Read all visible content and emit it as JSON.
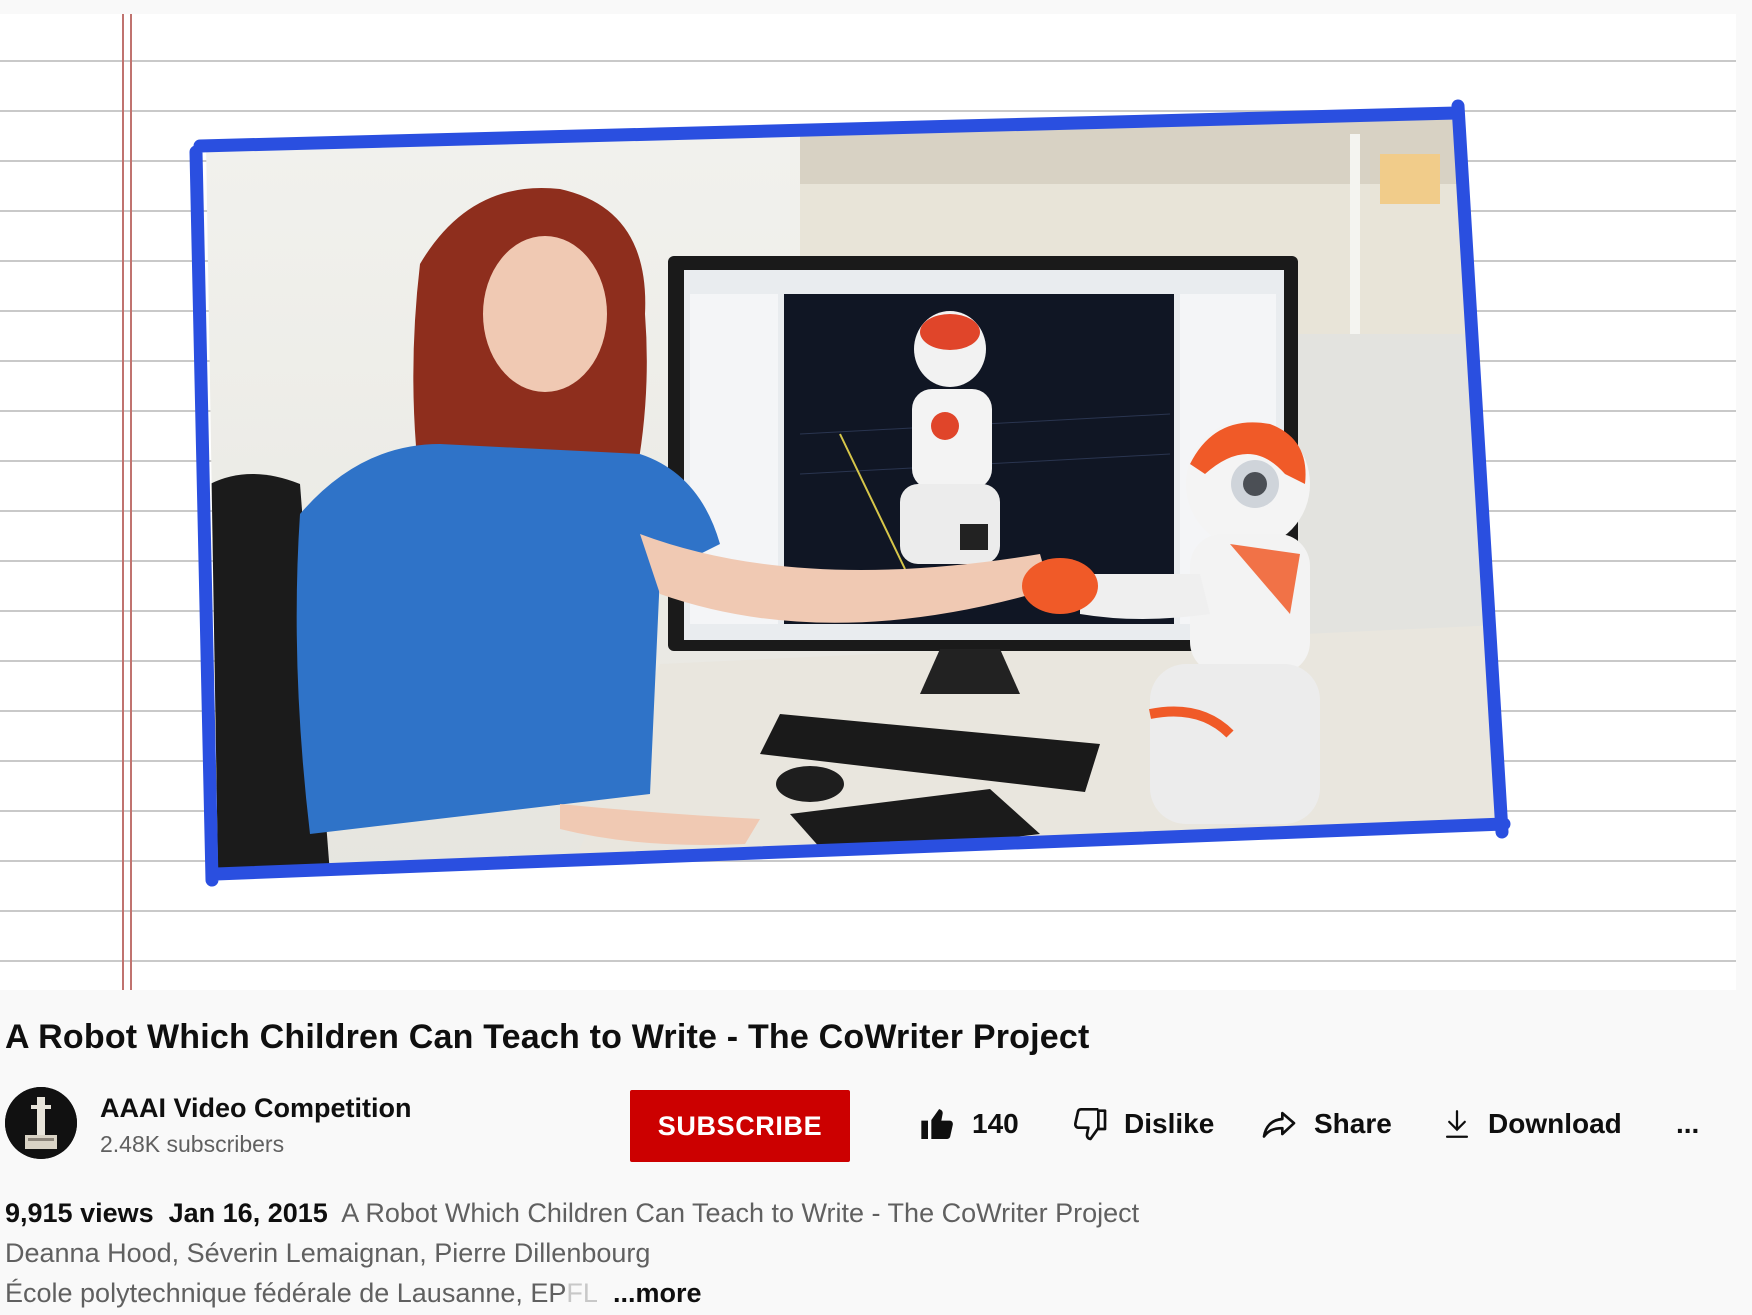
{
  "video": {
    "title": "A Robot Which Children Can Teach to Write - The CoWriter Project"
  },
  "channel": {
    "name": "AAAI Video Competition",
    "subscribers": "2.48K subscribers"
  },
  "actions": {
    "subscribe_label": "SUBSCRIBE",
    "like_count": "140",
    "dislike_label": "Dislike",
    "share_label": "Share",
    "download_label": "Download",
    "more_actions_label": "..."
  },
  "description": {
    "views": "9,915 views",
    "date": "Jan 16, 2015",
    "line1_text": "A Robot Which Children Can Teach to Write - The CoWriter Project",
    "line2": "Deanna Hood, Séverin Lemaignan, Pierre Dillenbourg",
    "line3_start": "École polytechnique fédérale de Lausanne, EP",
    "line3_fade": "FL",
    "more_label": "...more"
  },
  "colors": {
    "subscribe_bg": "#cc0000",
    "frame_border": "#2a4fe0",
    "page_bg": "#f9f9f9",
    "robot_accent": "#f05a28"
  }
}
